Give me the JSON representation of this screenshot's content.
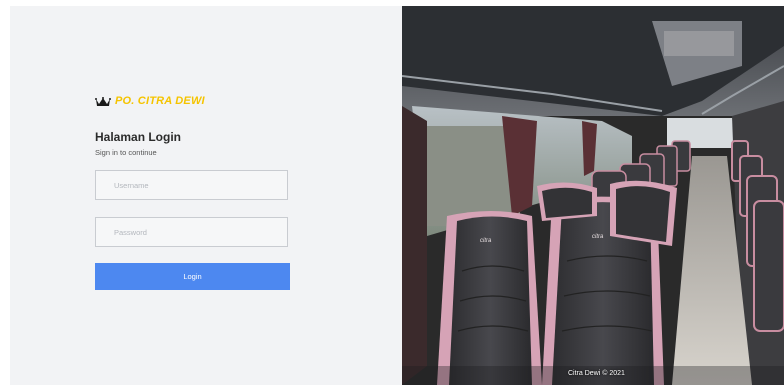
{
  "brand": {
    "name": "PO. CITRA DEWI",
    "logo_icon": "crown-icon",
    "color": "#f5c400"
  },
  "login": {
    "title": "Halaman Login",
    "subtitle": "Sign in to continue",
    "username_placeholder": "Username",
    "password_placeholder": "Password",
    "button_label": "Login",
    "button_color": "#4d88f0"
  },
  "photo": {
    "caption": "Citra Dewi © 2021",
    "seat_logo_text": "citra"
  }
}
